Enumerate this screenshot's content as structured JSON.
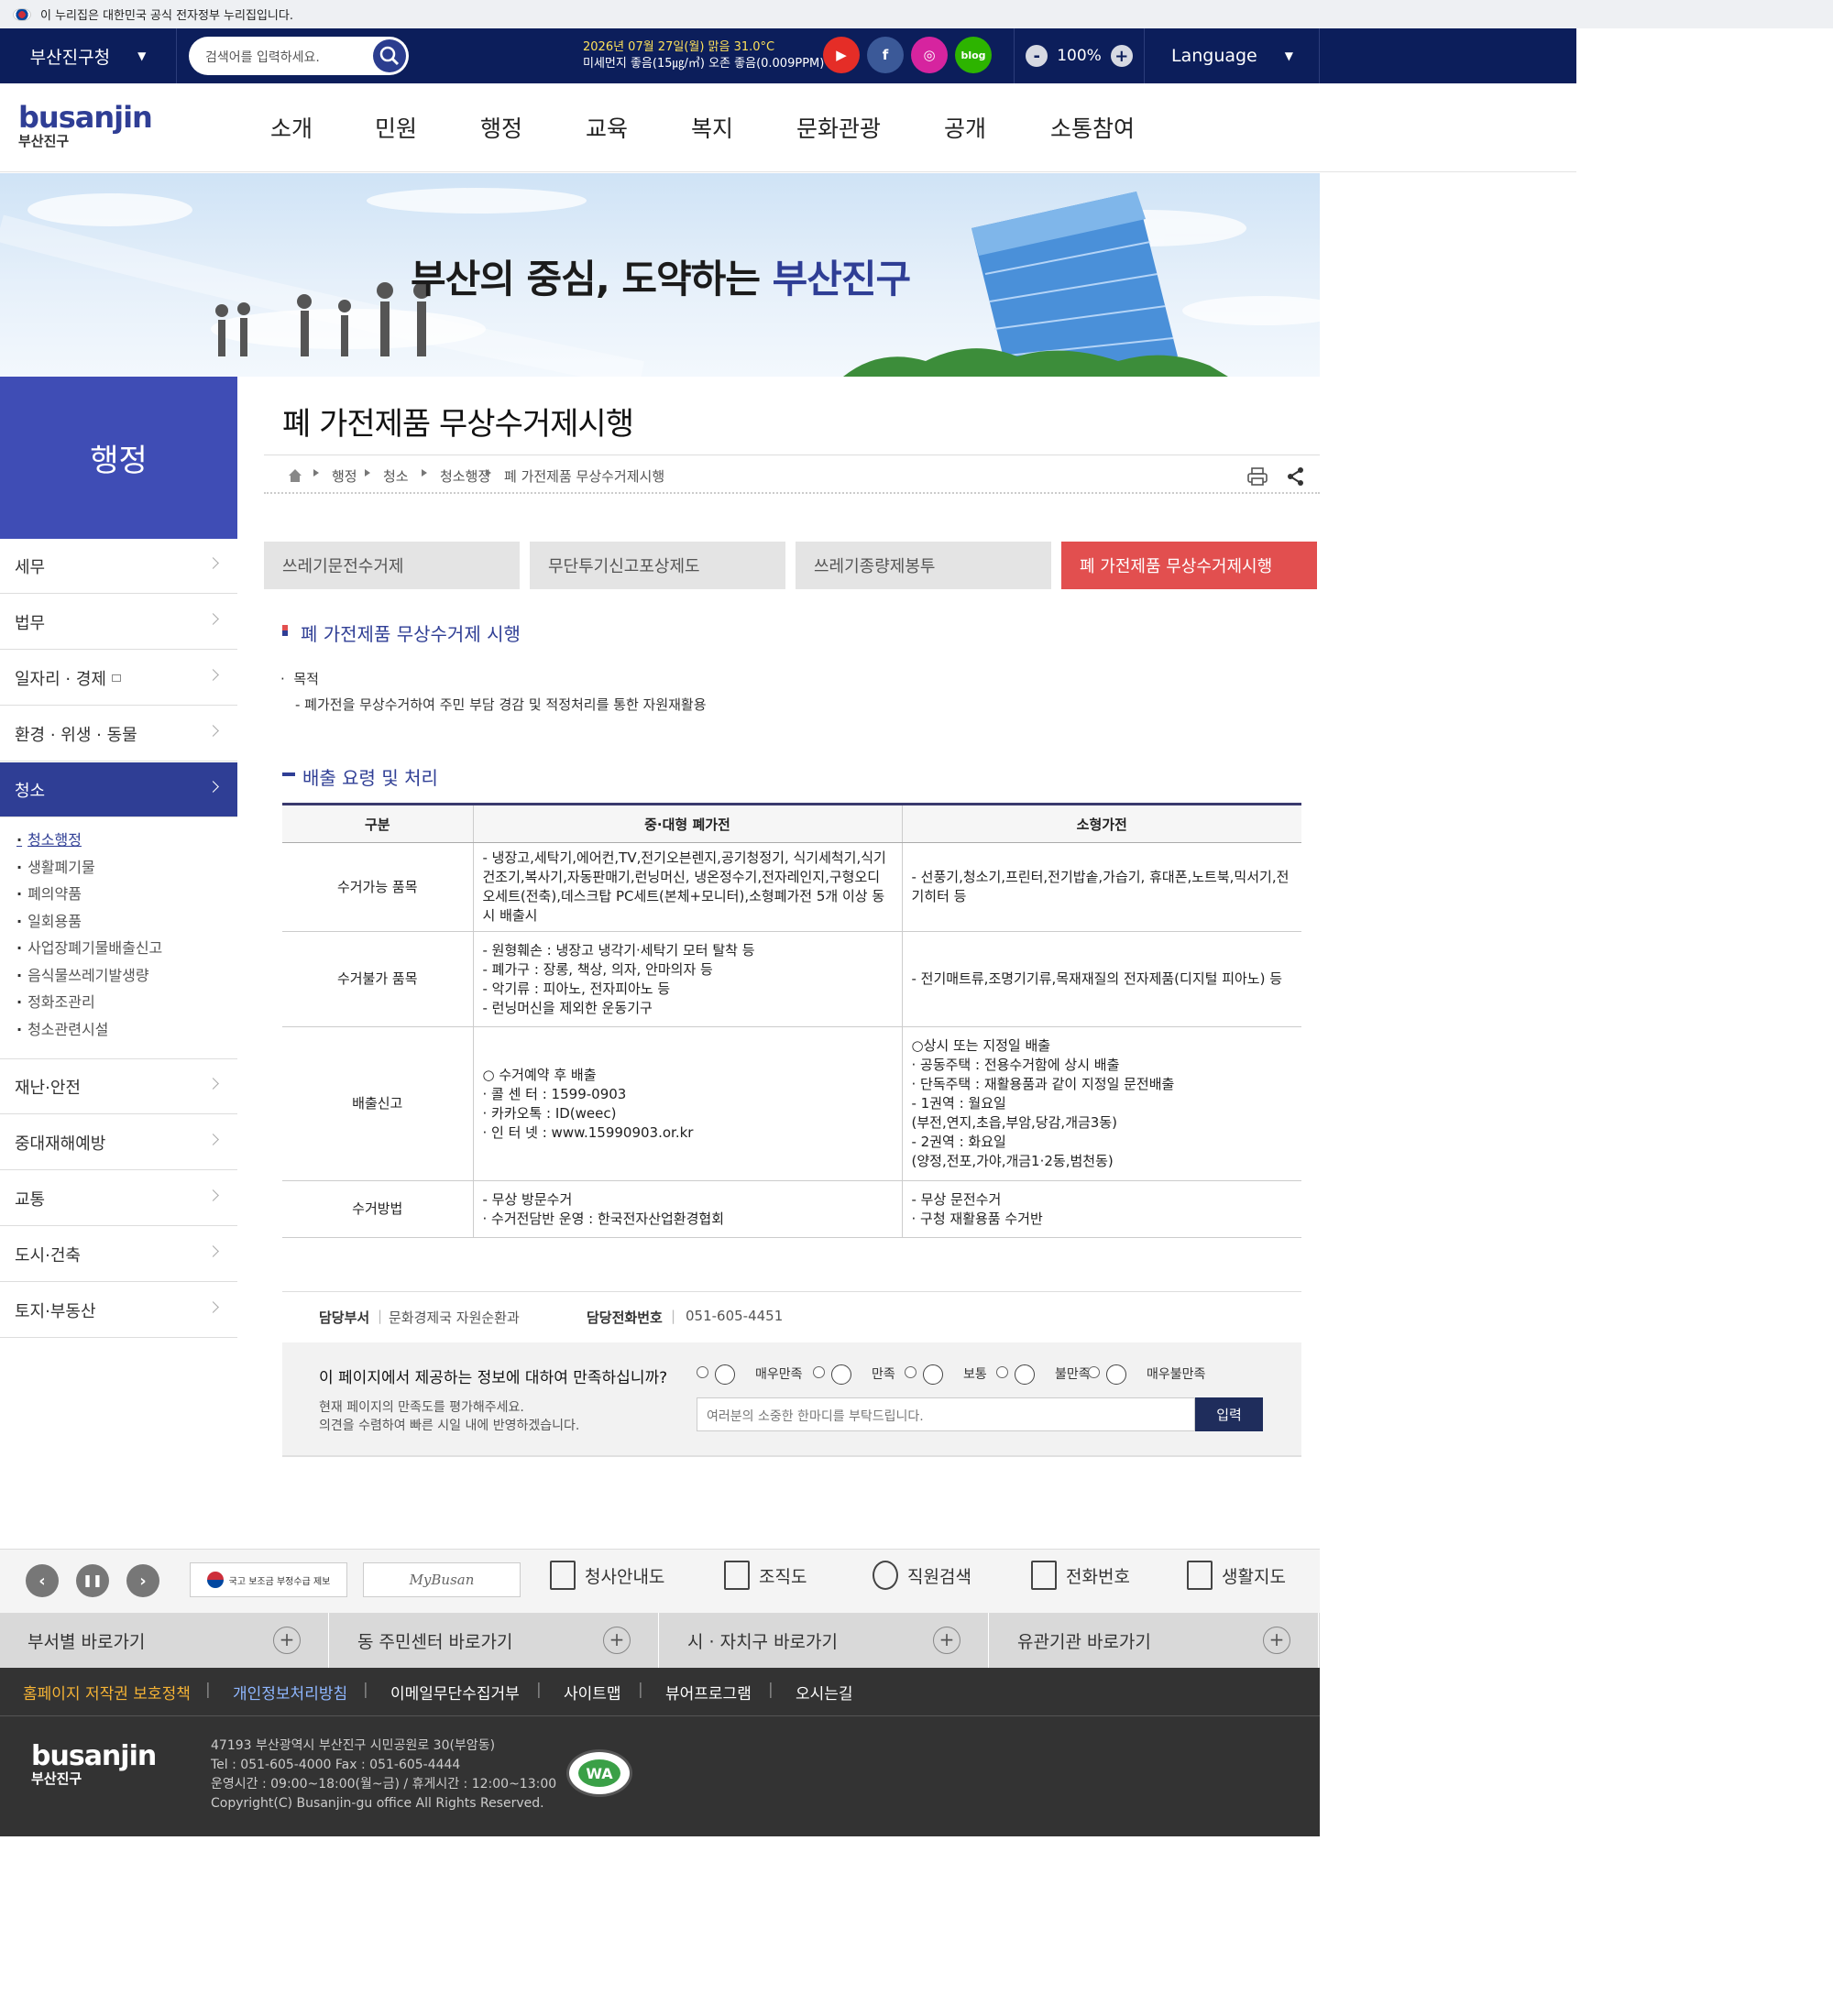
{
  "gov_banner": "이 누리집은 대한민국 공식 전자정부 누리집입니다.",
  "topbar": {
    "district": "부산진구청",
    "search_placeholder": "검색어를 입력하세요.",
    "weather_line1": "2026년 07월 27일(월) 맑음 31.0°C",
    "weather_line2": "미세먼지 좋음(15㎍/㎥) 오존 좋음(0.009PPM)",
    "sns": [
      {
        "name": "youtube-icon",
        "glyph": "▶",
        "color": "#e52d27"
      },
      {
        "name": "facebook-icon",
        "glyph": "f",
        "color": "#3b5998"
      },
      {
        "name": "instagram-icon",
        "glyph": "◎",
        "color": "#d6249f"
      },
      {
        "name": "blog-icon",
        "glyph": "blog",
        "color": "#2db400"
      }
    ],
    "zoom_minus": "-",
    "zoom_level": "100%",
    "zoom_plus": "+",
    "language": "Language"
  },
  "header": {
    "logo_en_a": "busan",
    "logo_en_b": "jin",
    "logo_ko": "부산진구",
    "menu": [
      "소개",
      "민원",
      "행정",
      "교육",
      "복지",
      "문화관광",
      "공개",
      "소통참여"
    ]
  },
  "hero": {
    "slogan_a": "부산의 중심, 도약하는 ",
    "slogan_b": "부산진구"
  },
  "sidebar": {
    "title": "행정",
    "items_top": [
      "세무",
      "법무",
      "일자리 · 경제",
      "환경 · 위생 · 동물"
    ],
    "active": "청소",
    "sub": [
      "청소행정",
      "생활폐기물",
      "폐의약품",
      "일회용품",
      "사업장폐기물배출신고",
      "음식물쓰레기발생량",
      "정화조관리",
      "청소관련시설"
    ],
    "items_bottom": [
      "재난·안전",
      "중대재해예방",
      "교통",
      "도시·건축",
      "토지·부동산"
    ]
  },
  "page": {
    "title": "폐 가전제품 무상수거제시행",
    "breadcrumb": [
      "행정",
      "청소",
      "청소행정",
      "폐 가전제품 무상수거제시행"
    ],
    "tabs": [
      "쓰레기문전수거제",
      "무단투기신고포상제도",
      "쓰레기종량제봉투",
      "폐 가전제품 무상수거제시행"
    ],
    "section1": "폐 가전제품 무상수거제 시행",
    "purpose_label": "목적",
    "purpose_text": "- 폐가전을 무상수거하여 주민 부담 경감 및 적정처리를 통한 자원재활용",
    "section2": "배출 요령 및 처리"
  },
  "table": {
    "headers": [
      "구분",
      "중·대형 폐가전",
      "소형가전"
    ],
    "rows": [
      {
        "label": "수거가능 품목",
        "large": [
          "- 냉장고,세탁기,에어컨,TV,전기오븐렌지,공기청정기, 식기세척기,식기건조기,복사기,자동판매기,런닝머신, 냉온정수기,전자레인지,구형오디오세트(전축),데스크탑 PC세트(본체+모니터),소형폐가전 5개 이상 동시 배출시"
        ],
        "small": [
          "- 선풍기,청소기,프린터,전기밥솥,가습기, 휴대폰,노트북,믹서기,전기히터 등"
        ]
      },
      {
        "label": "수거불가 품목",
        "large": [
          "- 원형훼손 : 냉장고 냉각기·세탁기 모터 탈착 등",
          "- 폐가구 : 장롱, 책상, 의자, 안마의자 등",
          "- 악기류 : 피아노, 전자피아노 등",
          "- 런닝머신을 제외한 운동기구"
        ],
        "small": [
          "- 전기매트류,조명기기류,목재재질의 전자제품(디지털 피아노) 등"
        ]
      },
      {
        "label": "배출신고",
        "large": [
          "○ 수거예약 후 배출",
          "· 콜 센 터 : 1599-0903",
          "· 카카오톡 : ID(weec)",
          "· 인 터 넷 : www.15990903.or.kr"
        ],
        "small": [
          "○상시 또는 지정일 배출",
          "· 공동주택 : 전용수거함에 상시 배출",
          "· 단독주택 : 재활용품과 같이 지정일 문전배출",
          "- 1권역 : 월요일",
          "(부전,연지,초읍,부암,당감,개금3동)",
          "- 2권역 : 화요일",
          "(양정,전포,가야,개금1·2동,범천동)"
        ]
      },
      {
        "label": "수거방법",
        "large": [
          "- 무상 방문수거",
          "· 수거전담반 운영 : 한국전자산업환경협회"
        ],
        "small": [
          "- 무상 문전수거",
          "· 구청 재활용품 수거반"
        ]
      }
    ]
  },
  "manager": {
    "dept_label": "담당부서",
    "dept": "문화경제국 자원순환과",
    "tel_label": "담당전화번호",
    "tel": "051-605-4451"
  },
  "survey": {
    "question": "이 페이지에서 제공하는 정보에 대하여 만족하십니까?",
    "desc1": "현재 페이지의 만족도를 평가해주세요.",
    "desc2": "의견을 수렴하여 빠른 시일 내에 반영하겠습니다.",
    "options": [
      "매우만족",
      "만족",
      "보통",
      "불만족",
      "매우불만족"
    ],
    "placeholder": "여러분의 소중한 한마디를 부탁드립니다.",
    "submit": "입력"
  },
  "footer": {
    "banner1": "국고 보조금 부정수급 제보",
    "banner2": "MyBusan",
    "links": [
      "청사안내도",
      "조직도",
      "직원검색",
      "전화번호",
      "생활지도"
    ],
    "quick": [
      "부서별 바로가기",
      "동 주민센터 바로가기",
      "시 · 자치구 바로가기",
      "유관기관 바로가기"
    ],
    "policy": [
      "홈페이지 저작권 보호정책",
      "개인정보처리방침",
      "이메일무단수집거부",
      "사이트맵",
      "뷰어프로그램",
      "오시는길"
    ],
    "address": "47193 부산광역시 부산진구 시민공원로 30(부암동)",
    "tel": "Tel : 051-605-4000 Fax : 051-605-4444",
    "hours": "운영시간 : 09:00~18:00(월~금) / 휴게시간 : 12:00~13:00",
    "copyright": "Copyright(C) Busanjin-gu office All Rights Reserved.",
    "wa_mark": "WA"
  }
}
